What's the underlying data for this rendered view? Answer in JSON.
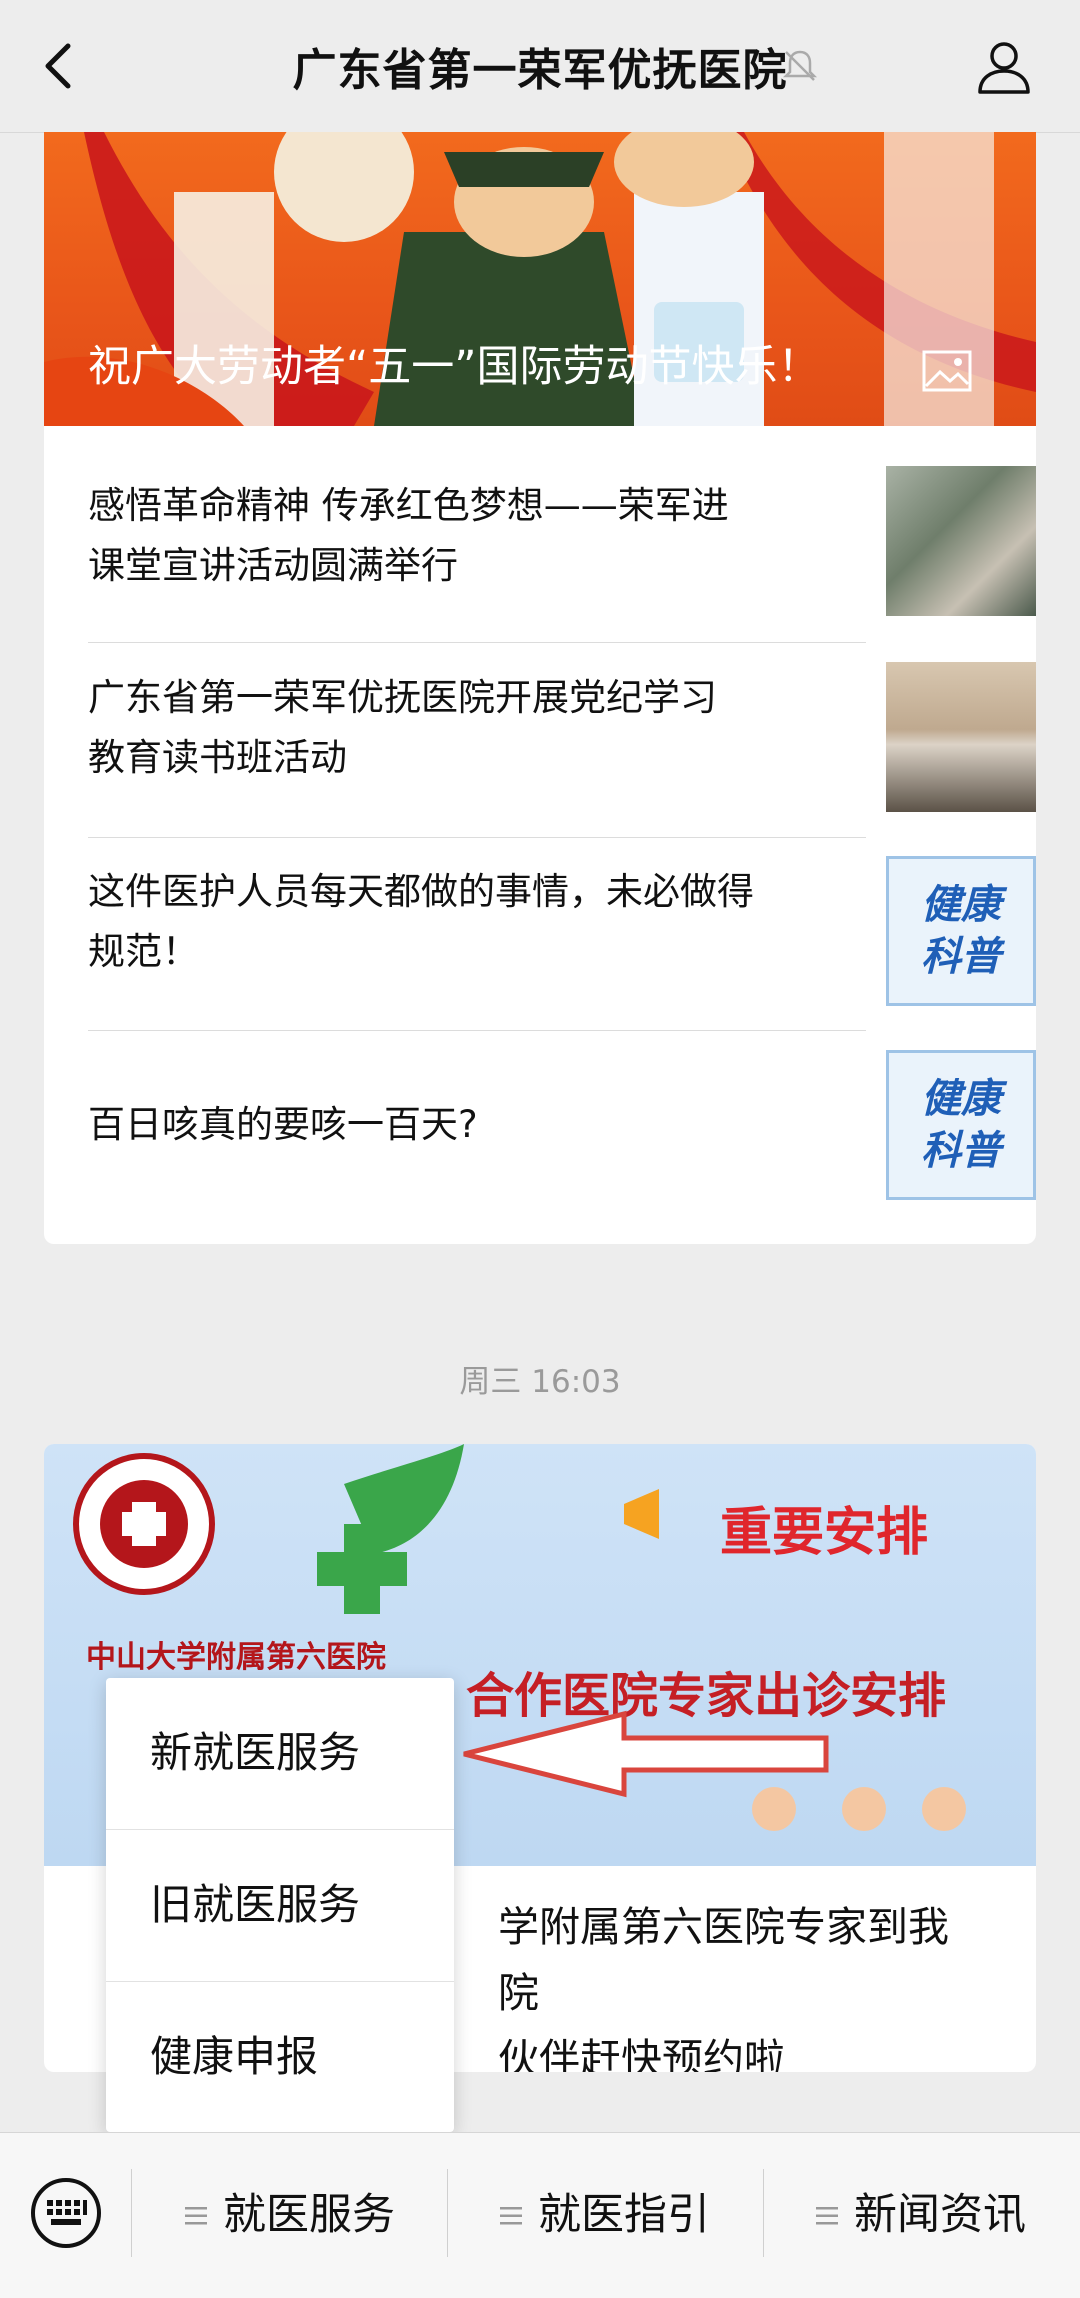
{
  "header": {
    "title": "广东省第一荣军优抚医院",
    "back_icon": "chevron-left-icon",
    "mute_icon": "bell-off-icon",
    "profile_icon": "person-icon"
  },
  "article_card": {
    "banner_caption": "祝广大劳动者“五一”国际劳动节快乐！",
    "banner_icon": "image-icon",
    "items": [
      {
        "title_line1": "感悟革命精神 传承红色梦想——荣军进",
        "title_line2": "课堂宣讲活动圆满举行"
      },
      {
        "title_line1": "广东省第一荣军优抚医院开展党纪学习",
        "title_line2": "教育读书班活动"
      },
      {
        "title_line1": "这件医护人员每天都做的事情，未必做得",
        "title_line2": "规范！",
        "thumb_text1": "健康",
        "thumb_text2": "科普"
      },
      {
        "title_line1": "百日咳真的要咳一百天?",
        "thumb_text1": "健康",
        "thumb_text2": "科普"
      }
    ]
  },
  "timestamp": "周三 16:03",
  "second_card": {
    "banner_hospital": "中山大学附属第六医院",
    "banner_heading": "重要安排",
    "banner_subheading": "合作医院专家出诊安排",
    "title_line1": "学附属第六医院专家到我院",
    "title_line2": "伙伴赶快预约啦"
  },
  "popup_menu": {
    "items": [
      "新就医服务",
      "旧就医服务",
      "健康申报"
    ]
  },
  "bottom_menu": {
    "keyboard_icon": "keyboard-icon",
    "items": [
      "就医服务",
      "就医指引",
      "新闻资讯"
    ]
  },
  "colors": {
    "background": "#ededed",
    "banner_orange": "#f26a1d",
    "banner_blue": "#cfe3f7",
    "arrow_red": "#d9453d",
    "health_blue": "#1f5fb7"
  }
}
